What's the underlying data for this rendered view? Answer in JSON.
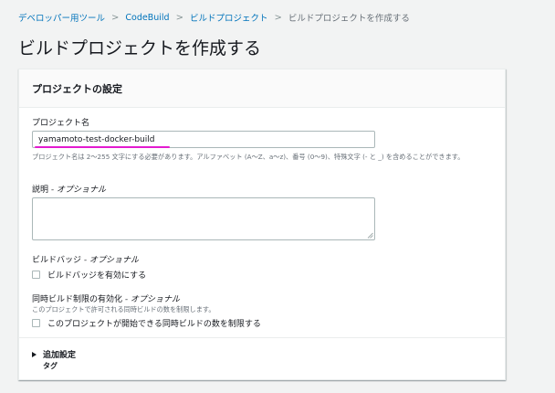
{
  "breadcrumb": {
    "items": [
      "デベロッパー用ツール",
      "CodeBuild",
      "ビルドプロジェクト"
    ],
    "current": "ビルドプロジェクトを作成する",
    "separator": ">"
  },
  "page": {
    "title": "ビルドプロジェクトを作成する"
  },
  "panel": {
    "title": "プロジェクトの設定",
    "project_name": {
      "label": "プロジェクト名",
      "value": "yamamoto-test-docker-build",
      "hint": "プロジェクト名は 2〜255 文字にする必要があります。アルファベット (A〜Z、a〜z)、番号 (0〜9)、特殊文字 (- と _) を含めることができます。"
    },
    "description": {
      "label": "説明",
      "optional": " - オプショナル",
      "value": ""
    },
    "build_badge": {
      "label": "ビルドバッジ",
      "optional": " - オプショナル",
      "checkbox_label": "ビルドバッジを有効にする"
    },
    "concurrency": {
      "label": "同時ビルド制限の有効化",
      "optional": " - オプショナル",
      "hint": "このプロジェクトで許可される同時ビルドの数を制限します。",
      "checkbox_label": "このプロジェクトが開始できる同時ビルドの数を制限する"
    },
    "additional": {
      "label": "追加設定",
      "sub": "タグ"
    }
  },
  "colors": {
    "link": "#0073bb",
    "underline_annotation": "#e31bd0",
    "background": "#f2f3f3"
  }
}
